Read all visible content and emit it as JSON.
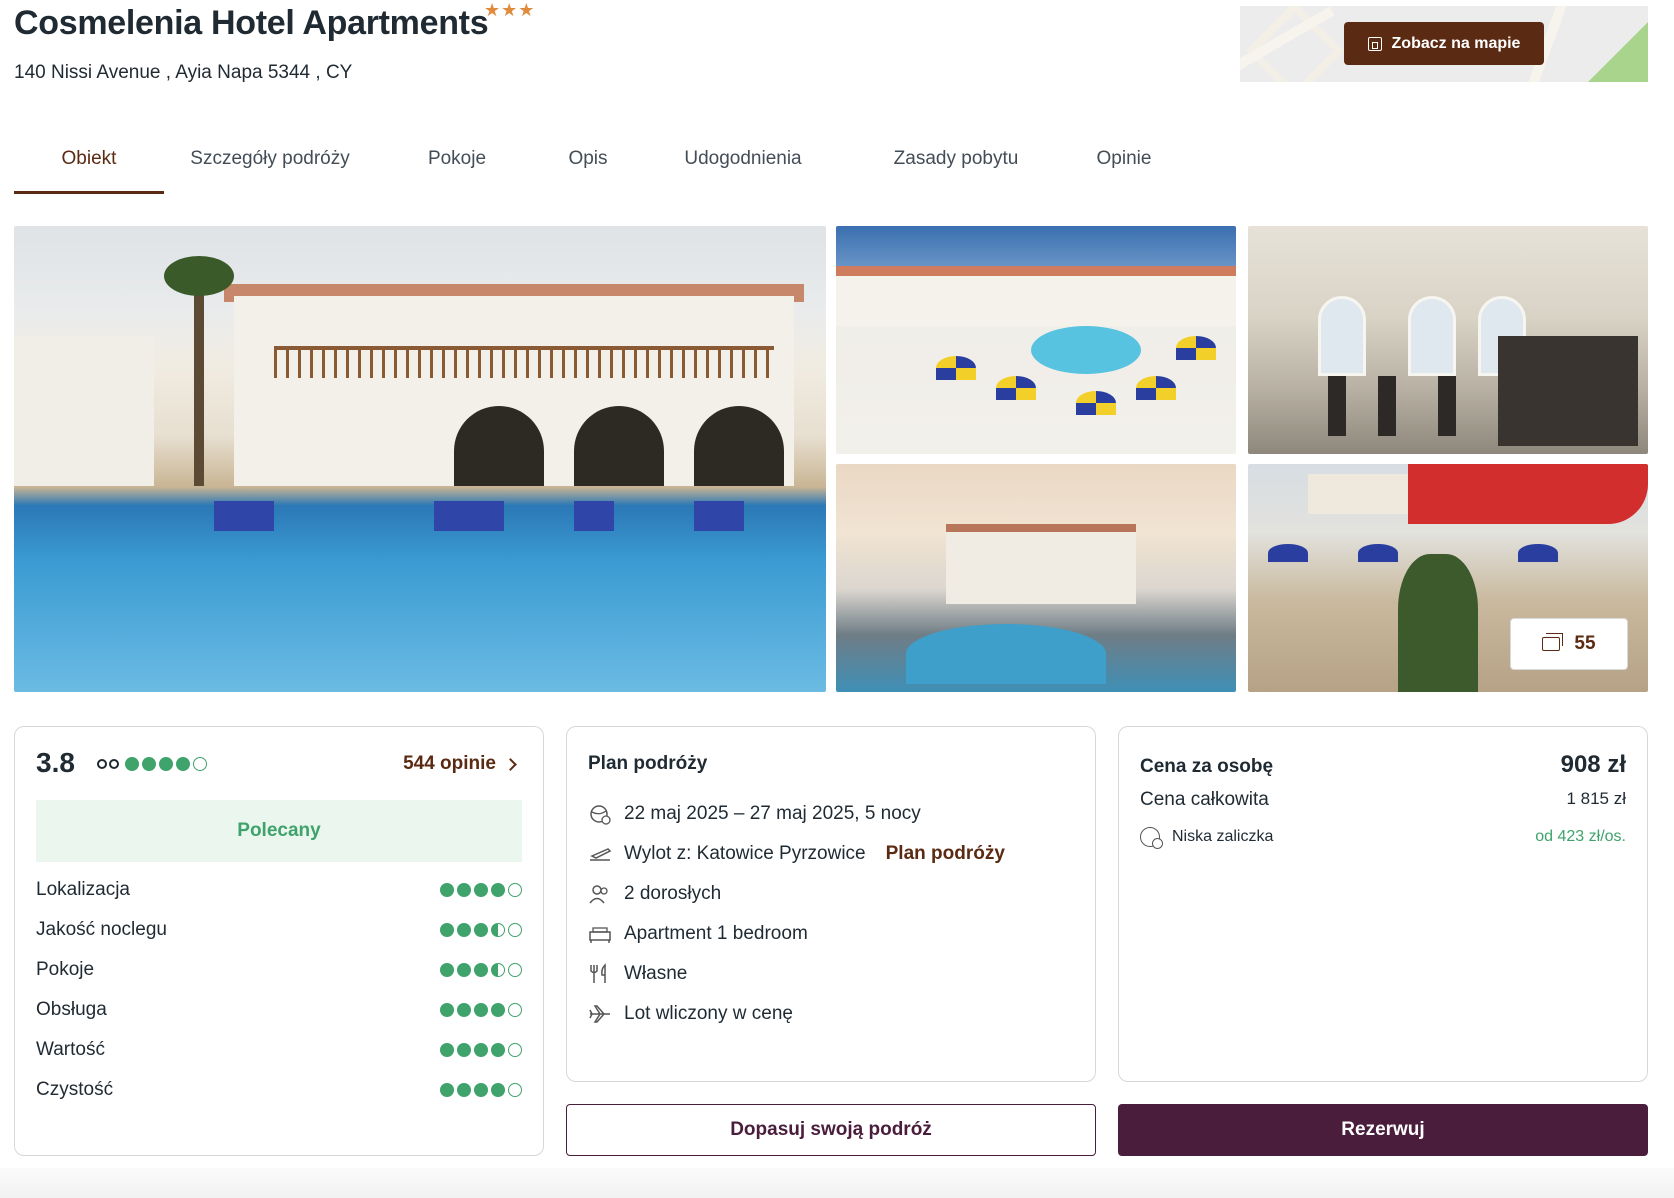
{
  "hotel": {
    "name": "Cosmelenia Hotel Apartments",
    "stars": "★★★",
    "address": "140 Nissi Avenue , Ayia Napa 5344 , CY"
  },
  "map": {
    "button_label": "Zobacz na mapie",
    "icon": "map-pin-icon"
  },
  "tabs": [
    {
      "label": "Obiekt",
      "active": true
    },
    {
      "label": "Szczegóły podróży",
      "active": false
    },
    {
      "label": "Pokoje",
      "active": false
    },
    {
      "label": "Opis",
      "active": false
    },
    {
      "label": "Udogodnienia",
      "active": false
    },
    {
      "label": "Zasady pobytu",
      "active": false
    },
    {
      "label": "Opinie",
      "active": false
    }
  ],
  "gallery": {
    "photo_count": "55",
    "icon": "photos-icon"
  },
  "reviews": {
    "score": "3.8",
    "tripadvisor_rating": 4,
    "count_label": "544 opinie",
    "badge": "Polecany",
    "categories": [
      {
        "label": "Lokalizacja",
        "rating": 4
      },
      {
        "label": "Jakość noclegu",
        "rating": 3.5
      },
      {
        "label": "Pokoje",
        "rating": 3.5
      },
      {
        "label": "Obsługa",
        "rating": 4
      },
      {
        "label": "Wartość",
        "rating": 4
      },
      {
        "label": "Czystość",
        "rating": 4
      }
    ]
  },
  "plan": {
    "title": "Plan podróży",
    "dates": "22 maj 2025 – 27 maj 2025, 5 nocy",
    "departure": "Wylot z: Katowice Pyrzowice",
    "departure_link": "Plan podróży",
    "travelers": "2 dorosłych",
    "room": "Apartment 1 bedroom",
    "board": "Własne",
    "flight": "Lot wliczony w cenę"
  },
  "price": {
    "per_person_label": "Cena za osobę",
    "per_person_value": "908 zł",
    "total_label": "Cena całkowita",
    "total_value": "1 815 zł",
    "deposit_label": "Niska zaliczka",
    "deposit_value": "od 423 zł/os."
  },
  "actions": {
    "adjust_label": "Dopasuj swoją podróż",
    "book_label": "Rezerwuj"
  },
  "colors": {
    "brand": "#5b2a12",
    "primary_button": "#4a1d3c",
    "rating_green": "#3fa36b",
    "recommended_bg": "#eaf6ee"
  }
}
